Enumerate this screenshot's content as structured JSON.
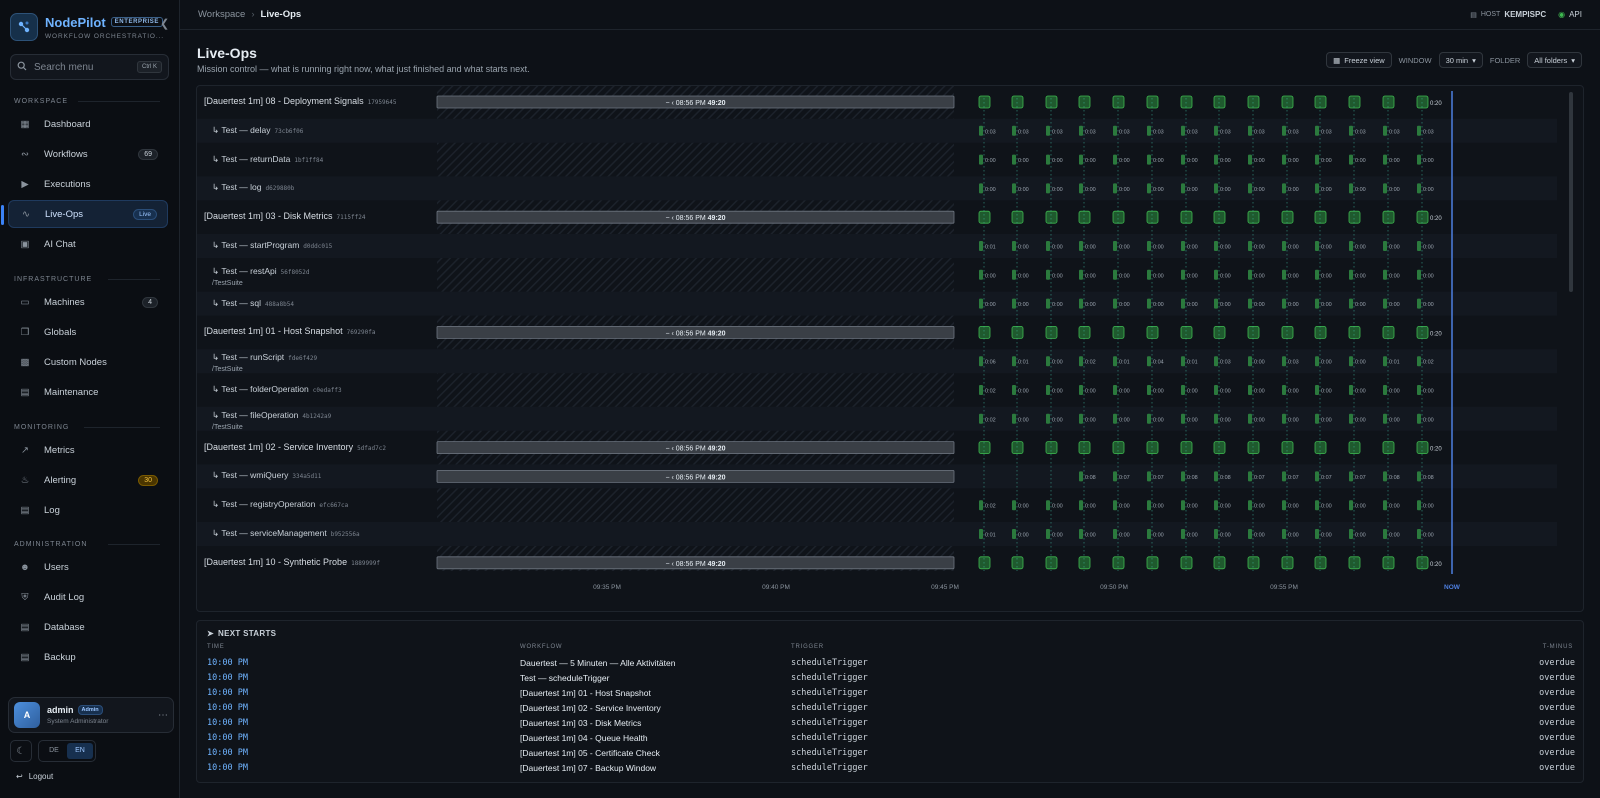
{
  "brand": {
    "name": "NodePilot",
    "badge": "ENTERPRISE",
    "subtitle": "WORKFLOW ORCHESTRATIO..."
  },
  "search": {
    "placeholder": "Search menu",
    "shortcut": "Ctrl K"
  },
  "sidebar": {
    "sections": [
      {
        "label": "WORKSPACE",
        "items": [
          {
            "label": "Dashboard",
            "icon": "dashboard-icon"
          },
          {
            "label": "Workflows",
            "icon": "workflows-icon",
            "count": "69"
          },
          {
            "label": "Executions",
            "icon": "play-icon"
          },
          {
            "label": "Live-Ops",
            "icon": "pulse-icon",
            "badge": "Live",
            "active": true
          },
          {
            "label": "AI Chat",
            "icon": "chat-icon"
          }
        ]
      },
      {
        "label": "INFRASTRUCTURE",
        "items": [
          {
            "label": "Machines",
            "icon": "monitor-icon",
            "count": "4"
          },
          {
            "label": "Globals",
            "icon": "globals-icon"
          },
          {
            "label": "Custom Nodes",
            "icon": "grid-icon"
          },
          {
            "label": "Maintenance",
            "icon": "calendar-icon"
          }
        ]
      },
      {
        "label": "MONITORING",
        "items": [
          {
            "label": "Metrics",
            "icon": "chart-icon"
          },
          {
            "label": "Alerting",
            "icon": "bell-icon",
            "count": "30",
            "alert": true
          },
          {
            "label": "Log",
            "icon": "file-icon"
          }
        ]
      },
      {
        "label": "ADMINISTRATION",
        "items": [
          {
            "label": "Users",
            "icon": "users-icon"
          },
          {
            "label": "Audit Log",
            "icon": "shield-icon"
          },
          {
            "label": "Database",
            "icon": "database-icon"
          },
          {
            "label": "Backup",
            "icon": "backup-icon"
          }
        ]
      }
    ]
  },
  "user": {
    "initial": "A",
    "name": "admin",
    "role": "Admin",
    "title": "System Administrator"
  },
  "lang": {
    "de": "DE",
    "en": "EN"
  },
  "logout": "Logout",
  "breadcrumb": {
    "root": "Workspace",
    "current": "Live-Ops"
  },
  "host": {
    "label": "HOST",
    "name": "KEMPISPC"
  },
  "api": "API",
  "page": {
    "title": "Live-Ops",
    "subtitle": "Mission control — what is running right now, what just finished and what starts next."
  },
  "controls": {
    "freeze": "Freeze view",
    "window_label": "WINDOW",
    "window_value": "30 min",
    "folder_label": "FOLDER",
    "folder_value": "All folders"
  },
  "timeline": {
    "running_label": "08:56 PM",
    "running_duration": "49:20",
    "now_label": "NOW",
    "axis": [
      "09:35 PM",
      "09:40 PM",
      "09:45 PM",
      "09:50 PM",
      "09:55 PM"
    ],
    "rows": [
      {
        "kind": "group",
        "label": "[Dauertest 1m] 08 - Deployment Signals",
        "hash": "17959645",
        "running": true,
        "values": [
          "0:20"
        ]
      },
      {
        "kind": "child",
        "label": "Test — delay",
        "hash": "73cb6f06",
        "values": [
          "0:03",
          "0:03",
          "0:03",
          "0:03",
          "0:03",
          "0:03",
          "0:03",
          "0:03",
          "0:03",
          "0:03",
          "0:03",
          "0:03",
          "0:03",
          "0:03"
        ]
      },
      {
        "kind": "child",
        "label": "Test — returnData",
        "hash": "1bf1ff84",
        "values": [
          "0:00",
          "0:00",
          "0:00",
          "0:00",
          "0:00",
          "0:00",
          "0:00",
          "0:00",
          "0:00",
          "0:00",
          "0:00",
          "0:00",
          "0:00",
          "0:00"
        ]
      },
      {
        "kind": "child",
        "label": "Test — log",
        "hash": "d629880b",
        "values": [
          "0:00",
          "0:00",
          "0:00",
          "0:00",
          "0:00",
          "0:00",
          "0:00",
          "0:00",
          "0:00",
          "0:00",
          "0:00",
          "0:00",
          "0:00",
          "0:00"
        ]
      },
      {
        "kind": "group",
        "label": "[Dauertest 1m] 03 - Disk Metrics",
        "hash": "7115ff24",
        "running": true,
        "values": [
          "0:20"
        ]
      },
      {
        "kind": "child",
        "label": "Test — startProgram",
        "hash": "d0ddc015",
        "values": [
          "0:01",
          "0:00",
          "0:00",
          "0:00",
          "0:00",
          "0:00",
          "0:00",
          "0:00",
          "0:00",
          "0:00",
          "0:00",
          "0:00",
          "0:00",
          "0:00"
        ]
      },
      {
        "kind": "child",
        "label": "Test — restApi",
        "hash": "56f8052d",
        "sub": "/TestSuite",
        "values": [
          "0:00",
          "0:00",
          "0:00",
          "0:00",
          "0:00",
          "0:00",
          "0:00",
          "0:00",
          "0:00",
          "0:00",
          "0:00",
          "0:00",
          "0:00",
          "0:00"
        ]
      },
      {
        "kind": "child",
        "label": "Test — sql",
        "hash": "488a8b54",
        "values": [
          "0:00",
          "0:00",
          "0:00",
          "0:00",
          "0:00",
          "0:00",
          "0:00",
          "0:00",
          "0:00",
          "0:00",
          "0:00",
          "0:00",
          "0:00",
          "0:00"
        ]
      },
      {
        "kind": "group",
        "label": "[Dauertest 1m] 01 - Host Snapshot",
        "hash": "769290fa",
        "running": true,
        "values": [
          "0:20"
        ]
      },
      {
        "kind": "child",
        "label": "Test — runScript",
        "hash": "fde6f429",
        "sub": "/TestSuite",
        "values": [
          "0:06",
          "0:01",
          "0:00",
          "0:02",
          "0:01",
          "0:04",
          "0:01",
          "0:03",
          "0:00",
          "0:03",
          "0:00",
          "0:00",
          "0:01",
          "0:02"
        ]
      },
      {
        "kind": "child",
        "label": "Test — folderOperation",
        "hash": "c0edaff3",
        "values": [
          "0:02",
          "0:00",
          "0:00",
          "0:00",
          "0:00",
          "0:00",
          "0:00",
          "0:00",
          "0:00",
          "0:00",
          "0:00",
          "0:00",
          "0:00",
          "0:00"
        ]
      },
      {
        "kind": "child",
        "label": "Test — fileOperation",
        "hash": "4b1242a9",
        "sub": "/TestSuite",
        "values": [
          "0:02",
          "0:00",
          "0:00",
          "0:00",
          "0:00",
          "0:00",
          "0:00",
          "0:00",
          "0:00",
          "0:00",
          "0:00",
          "0:00",
          "0:00",
          "0:00"
        ]
      },
      {
        "kind": "group",
        "label": "[Dauertest 1m] 02 - Service Inventory",
        "hash": "5dfad7c2",
        "running": true,
        "values": [
          "0:20"
        ]
      },
      {
        "kind": "child",
        "label": "Test — wmiQuery",
        "hash": "334a5d11",
        "running": true,
        "values": [
          "0:08",
          "0:07",
          "0:07",
          "0:08",
          "0:08",
          "0:07",
          "0:07",
          "0:07",
          "0:07",
          "0:08",
          "0:08"
        ]
      },
      {
        "kind": "child",
        "label": "Test — registryOperation",
        "hash": "efc667ca",
        "values": [
          "0:02",
          "0:00",
          "0:00",
          "0:00",
          "0:00",
          "0:00",
          "0:00",
          "0:00",
          "0:00",
          "0:00",
          "0:00",
          "0:00",
          "0:00",
          "0:00"
        ]
      },
      {
        "kind": "child",
        "label": "Test — serviceManagement",
        "hash": "b952556a",
        "values": [
          "0:01",
          "0:00",
          "0:00",
          "0:00",
          "0:00",
          "0:00",
          "0:00",
          "0:00",
          "0:00",
          "0:00",
          "0:00",
          "0:00",
          "0:00",
          "0:00"
        ]
      },
      {
        "kind": "group",
        "label": "[Dauertest 1m] 10 - Synthetic Probe",
        "hash": "1889999f",
        "running": true,
        "values": [
          "0:20"
        ]
      }
    ]
  },
  "next_starts": {
    "title": "NEXT STARTS",
    "headers": {
      "time": "TIME",
      "workflow": "WORKFLOW",
      "trigger": "TRIGGER",
      "tminus": "T-MINUS"
    },
    "rows": [
      {
        "time": "10:00 PM",
        "workflow": "Dauertest — 5 Minuten — Alle Aktivitäten",
        "trigger": "scheduleTrigger",
        "tminus": "overdue"
      },
      {
        "time": "10:00 PM",
        "workflow": "Test — scheduleTrigger",
        "trigger": "scheduleTrigger",
        "tminus": "overdue"
      },
      {
        "time": "10:00 PM",
        "workflow": "[Dauertest 1m] 01 - Host Snapshot",
        "trigger": "scheduleTrigger",
        "tminus": "overdue"
      },
      {
        "time": "10:00 PM",
        "workflow": "[Dauertest 1m] 02 - Service Inventory",
        "trigger": "scheduleTrigger",
        "tminus": "overdue"
      },
      {
        "time": "10:00 PM",
        "workflow": "[Dauertest 1m] 03 - Disk Metrics",
        "trigger": "scheduleTrigger",
        "tminus": "overdue"
      },
      {
        "time": "10:00 PM",
        "workflow": "[Dauertest 1m] 04 - Queue Health",
        "trigger": "scheduleTrigger",
        "tminus": "overdue"
      },
      {
        "time": "10:00 PM",
        "workflow": "[Dauertest 1m] 05 - Certificate Check",
        "trigger": "scheduleTrigger",
        "tminus": "overdue"
      },
      {
        "time": "10:00 PM",
        "workflow": "[Dauertest 1m] 07 - Backup Window",
        "trigger": "scheduleTrigger",
        "tminus": "overdue"
      }
    ]
  },
  "colors": {
    "accent": "#3b82f6",
    "success": "#3fb950",
    "bg": "#0d1117"
  }
}
